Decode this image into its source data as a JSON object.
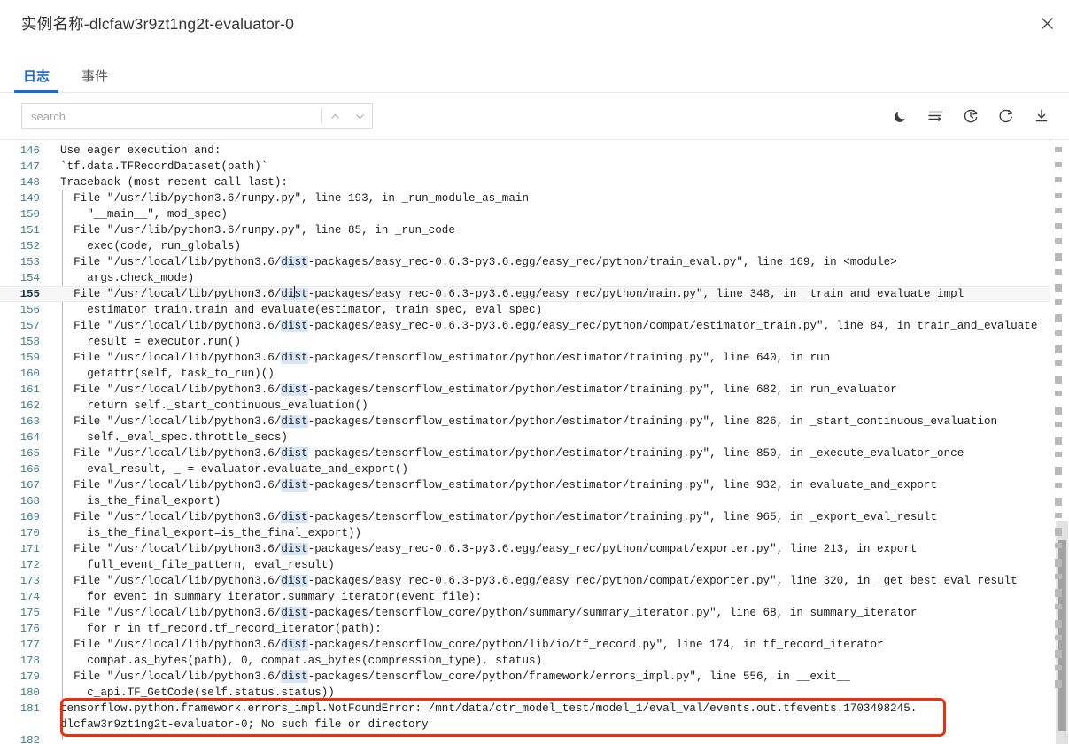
{
  "window": {
    "title": "实例名称-dlcfaw3r9zt1ng2t-evaluator-0",
    "close_icon": "close-icon"
  },
  "tabs": [
    {
      "label": "日志",
      "active": true
    },
    {
      "label": "事件",
      "active": false
    }
  ],
  "search": {
    "placeholder": "search",
    "value": "",
    "prev_icon": "chevron-up-icon",
    "next_icon": "chevron-down-icon"
  },
  "toolbar": {
    "icons": [
      {
        "name": "dark-mode-icon",
        "title": "夜间模式"
      },
      {
        "name": "wrap-lines-icon",
        "title": "自动换行"
      },
      {
        "name": "history-clock-icon",
        "title": "历史"
      },
      {
        "name": "refresh-icon",
        "title": "刷新"
      },
      {
        "name": "download-icon",
        "title": "下载"
      }
    ]
  },
  "accent": {
    "tab_active": "#1668dc",
    "line_number": "#3d7c8c",
    "search_highlight": "#d6e6f7",
    "annotation_border": "#f22d0d"
  },
  "log": {
    "active_line": 155,
    "search_term": "dist",
    "lines": [
      {
        "no": 146,
        "text": "Use eager execution and:"
      },
      {
        "no": 147,
        "text": "`tf.data.TFRecordDataset(path)`"
      },
      {
        "no": 148,
        "text": "Traceback (most recent call last):"
      },
      {
        "no": 149,
        "text": "  File \"/usr/lib/python3.6/runpy.py\", line 193, in _run_module_as_main"
      },
      {
        "no": 150,
        "text": "    \"__main__\", mod_spec)"
      },
      {
        "no": 151,
        "text": "  File \"/usr/lib/python3.6/runpy.py\", line 85, in _run_code"
      },
      {
        "no": 152,
        "text": "    exec(code, run_globals)"
      },
      {
        "no": 153,
        "text": "  File \"/usr/local/lib/python3.6/dist-packages/easy_rec-0.6.3-py3.6.egg/easy_rec/python/train_eval.py\", line 169, in <module>"
      },
      {
        "no": 154,
        "text": "    args.check_mode)"
      },
      {
        "no": 155,
        "text": "  File \"/usr/local/lib/python3.6/dist-packages/easy_rec-0.6.3-py3.6.egg/easy_rec/python/main.py\", line 348, in _train_and_evaluate_impl"
      },
      {
        "no": 156,
        "text": "    estimator_train.train_and_evaluate(estimator, train_spec, eval_spec)"
      },
      {
        "no": 157,
        "text": "  File \"/usr/local/lib/python3.6/dist-packages/easy_rec-0.6.3-py3.6.egg/easy_rec/python/compat/estimator_train.py\", line 84, in train_and_evaluate"
      },
      {
        "no": 158,
        "text": "    result = executor.run()"
      },
      {
        "no": 159,
        "text": "  File \"/usr/local/lib/python3.6/dist-packages/tensorflow_estimator/python/estimator/training.py\", line 640, in run"
      },
      {
        "no": 160,
        "text": "    getattr(self, task_to_run)()"
      },
      {
        "no": 161,
        "text": "  File \"/usr/local/lib/python3.6/dist-packages/tensorflow_estimator/python/estimator/training.py\", line 682, in run_evaluator"
      },
      {
        "no": 162,
        "text": "    return self._start_continuous_evaluation()"
      },
      {
        "no": 163,
        "text": "  File \"/usr/local/lib/python3.6/dist-packages/tensorflow_estimator/python/estimator/training.py\", line 826, in _start_continuous_evaluation"
      },
      {
        "no": 164,
        "text": "    self._eval_spec.throttle_secs)"
      },
      {
        "no": 165,
        "text": "  File \"/usr/local/lib/python3.6/dist-packages/tensorflow_estimator/python/estimator/training.py\", line 850, in _execute_evaluator_once"
      },
      {
        "no": 166,
        "text": "    eval_result, _ = evaluator.evaluate_and_export()"
      },
      {
        "no": 167,
        "text": "  File \"/usr/local/lib/python3.6/dist-packages/tensorflow_estimator/python/estimator/training.py\", line 932, in evaluate_and_export"
      },
      {
        "no": 168,
        "text": "    is_the_final_export)"
      },
      {
        "no": 169,
        "text": "  File \"/usr/local/lib/python3.6/dist-packages/tensorflow_estimator/python/estimator/training.py\", line 965, in _export_eval_result"
      },
      {
        "no": 170,
        "text": "    is_the_final_export=is_the_final_export))"
      },
      {
        "no": 171,
        "text": "  File \"/usr/local/lib/python3.6/dist-packages/easy_rec-0.6.3-py3.6.egg/easy_rec/python/compat/exporter.py\", line 213, in export"
      },
      {
        "no": 172,
        "text": "    full_event_file_pattern, eval_result)"
      },
      {
        "no": 173,
        "text": "  File \"/usr/local/lib/python3.6/dist-packages/easy_rec-0.6.3-py3.6.egg/easy_rec/python/compat/exporter.py\", line 320, in _get_best_eval_result"
      },
      {
        "no": 174,
        "text": "    for event in summary_iterator.summary_iterator(event_file):"
      },
      {
        "no": 175,
        "text": "  File \"/usr/local/lib/python3.6/dist-packages/tensorflow_core/python/summary/summary_iterator.py\", line 68, in summary_iterator"
      },
      {
        "no": 176,
        "text": "    for r in tf_record.tf_record_iterator(path):"
      },
      {
        "no": 177,
        "text": "  File \"/usr/local/lib/python3.6/dist-packages/tensorflow_core/python/lib/io/tf_record.py\", line 174, in tf_record_iterator"
      },
      {
        "no": 178,
        "text": "    compat.as_bytes(path), 0, compat.as_bytes(compression_type), status)"
      },
      {
        "no": 179,
        "text": "  File \"/usr/local/lib/python3.6/dist-packages/tensorflow_core/python/framework/errors_impl.py\", line 556, in __exit__"
      },
      {
        "no": 180,
        "text": "    c_api.TF_GetCode(self.status.status))"
      }
    ],
    "error_line": {
      "no": 181,
      "text_part1": "tensorflow.python.framework.errors_impl.NotFoundError: /mnt/data/ctr_model_test/model_1/eval_val/events.out.tfevents.1703498245.",
      "text_part2": "dlcfaw3r9zt1ng2t-evaluator-0; No such file or directory"
    },
    "last_line": {
      "no": 182,
      "text": ""
    }
  }
}
